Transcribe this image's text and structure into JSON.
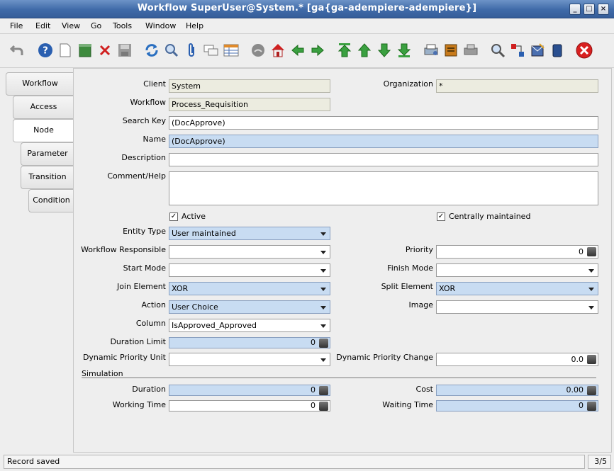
{
  "window": {
    "title": "Workflow  SuperUser@System.* [ga{ga-adempiere-adempiere}]"
  },
  "menu": [
    "File",
    "Edit",
    "View",
    "Go",
    "Tools",
    "Window",
    "Help"
  ],
  "toolbar_icons": [
    "undo-icon",
    "help-icon",
    "new-record-icon",
    "copy-record-icon",
    "delete-icon",
    "save-icon",
    "refresh-icon",
    "find-icon",
    "attachment-icon",
    "chat-icon",
    "grid-toggle-icon",
    "history-icon",
    "home-icon",
    "previous-tab-icon",
    "next-tab-icon",
    "first-record-icon",
    "previous-record-icon",
    "next-record-icon",
    "last-record-icon",
    "report-icon",
    "archive-icon",
    "print-icon",
    "zoom-across-icon",
    "workflow-icon",
    "request-icon",
    "product-info-icon",
    "exit-icon"
  ],
  "tabs": [
    "Workflow",
    "Access",
    "Node",
    "Parameter",
    "Transition",
    "Condition"
  ],
  "active_tab": "Node",
  "form": {
    "client_label": "Client",
    "client_value": "System",
    "organization_label": "Organization",
    "organization_value": "*",
    "workflow_label": "Workflow",
    "workflow_value": "Process_Requisition",
    "searchkey_label": "Search Key",
    "searchkey_value": "(DocApprove)",
    "name_label": "Name",
    "name_value": "(DocApprove)",
    "description_label": "Description",
    "description_value": "",
    "comment_label": "Comment/Help",
    "comment_value": "",
    "active_label": "Active",
    "active_checked": true,
    "central_label": "Centrally maintained",
    "central_checked": true,
    "entitytype_label": "Entity Type",
    "entitytype_value": "User maintained",
    "responsible_label": "Workflow Responsible",
    "responsible_value": "",
    "priority_label": "Priority",
    "priority_value": "0",
    "startmode_label": "Start Mode",
    "startmode_value": "",
    "finishmode_label": "Finish Mode",
    "finishmode_value": "",
    "join_label": "Join Element",
    "join_value": "XOR",
    "split_label": "Split Element",
    "split_value": "XOR",
    "action_label": "Action",
    "action_value": "User Choice",
    "image_label": "Image",
    "image_value": "",
    "column_label": "Column",
    "column_value": "IsApproved_Approved",
    "durationlimit_label": "Duration Limit",
    "durationlimit_value": "0",
    "dpu_label": "Dynamic Priority Unit",
    "dpu_value": "",
    "dpc_label": "Dynamic Priority Change",
    "dpc_value": "0.0",
    "simulation_label": "Simulation",
    "duration_label": "Duration",
    "duration_value": "0",
    "cost_label": "Cost",
    "cost_value": "0.00",
    "workingtime_label": "Working Time",
    "workingtime_value": "0",
    "waitingtime_label": "Waiting Time",
    "waitingtime_value": "0"
  },
  "status": {
    "message": "Record saved",
    "record_count": "3/5"
  }
}
